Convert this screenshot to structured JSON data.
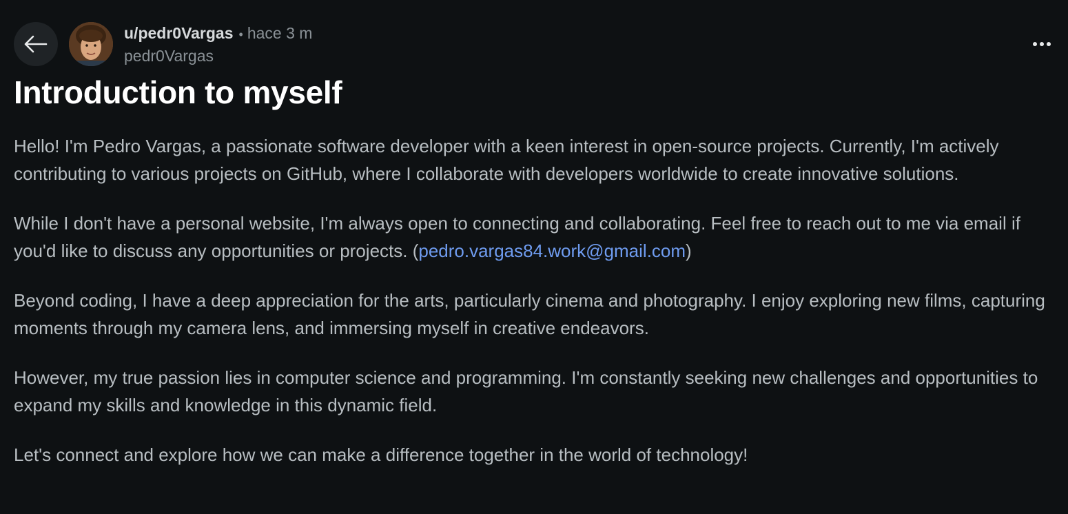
{
  "header": {
    "username": "u/pedr0Vargas",
    "separator": "•",
    "timestamp": "hace 3 m",
    "handle": "pedr0Vargas",
    "back_icon": "arrow-left-icon",
    "more_icon": "more-horizontal-icon"
  },
  "post": {
    "title": "Introduction to myself",
    "paragraphs": [
      "Hello! I'm Pedro Vargas, a passionate software developer with a keen interest in open-source projects. Currently, I'm actively contributing to various projects on GitHub, where I collaborate with developers worldwide to create innovative solutions.",
      {
        "before": "While I don't have a personal website, I'm always open to connecting and collaborating. Feel free to reach out to me via email if you'd like to discuss any opportunities or projects. (",
        "link": "pedro.vargas84.work@gmail.com",
        "after": ")"
      },
      "Beyond coding, I have a deep appreciation for the arts, particularly cinema and photography. I enjoy exploring new films, capturing moments through my camera lens, and immersing myself in creative endeavors.",
      "However, my true passion lies in computer science and programming. I'm constantly seeking new challenges and opportunities to expand my skills and knowledge in this dynamic field.",
      "Let's connect and explore how we can make a difference together in the world of technology!"
    ]
  },
  "colors": {
    "background": "#0e1113",
    "link": "#6f9cf0",
    "muted": "#8a9196"
  }
}
